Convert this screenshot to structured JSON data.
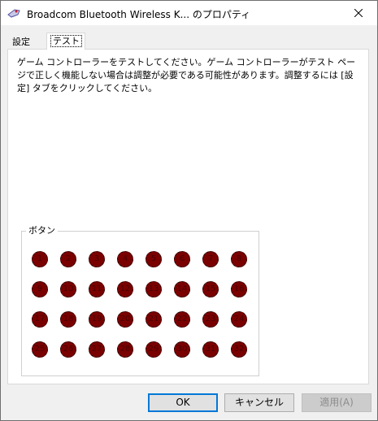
{
  "window": {
    "title": "Broadcom Bluetooth Wireless  K... のプロパティ",
    "icon": "joystick-icon"
  },
  "tabs": [
    {
      "label": "設定",
      "active": false
    },
    {
      "label": "テスト",
      "active": true
    }
  ],
  "content": {
    "description": "ゲーム コントローラーをテストしてください。ゲーム コントローラーがテスト ページで正しく機能しない場合は調整が必要である可能性があります。調整するには [設定] タブをクリックしてください。",
    "buttons_group_label": "ボタン",
    "buttons": [
      "1",
      "2",
      "3",
      "4",
      "5",
      "6",
      "7",
      "8",
      "9",
      "10",
      "11",
      "12",
      "13",
      "14",
      "15",
      "16",
      "17",
      "18",
      "19",
      "20",
      "21",
      "22",
      "23",
      "24",
      "25",
      "26",
      "27",
      "28",
      "29",
      "30",
      "31",
      "32"
    ],
    "button_color": "#7a0000"
  },
  "footer": {
    "ok": "OK",
    "cancel": "キャンセル",
    "apply": "適用(A)"
  }
}
